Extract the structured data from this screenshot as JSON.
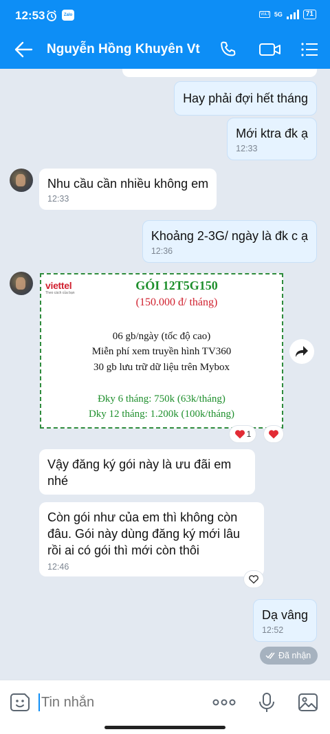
{
  "status_bar": {
    "time": "12:53",
    "zalo_label": "Zalo",
    "network": "5G",
    "volte": "VoLTE",
    "battery": "71"
  },
  "header": {
    "contact_name": "Nguyễn Hồng Khuyên Vt",
    "back_icon": "arrow-left-icon",
    "call_icon": "phone-icon",
    "video_icon": "video-camera-icon",
    "menu_icon": "list-menu-icon",
    "color": "#0d8ef6"
  },
  "messages": [
    {
      "from": "me",
      "text": "Hay phải đợi hết tháng",
      "time": ""
    },
    {
      "from": "me",
      "text": "Mới ktra đk ạ",
      "time": "12:33"
    },
    {
      "from": "them",
      "text": "Nhu cầu cần nhiều không em",
      "time": "12:33"
    },
    {
      "from": "me",
      "text": "Khoảng 2-3G/ ngày là đk c ạ",
      "time": "12:36"
    },
    {
      "from": "them",
      "text": "Vậy đăng ký gói này là ưu đãi em nhé",
      "time": ""
    },
    {
      "from": "them",
      "text": "Còn gói như của em thì không còn đâu. Gói này dùng đăng ký mới lâu rồi ai có gói thì mới còn thôi",
      "time": "12:46"
    },
    {
      "from": "me",
      "text": "Dạ vâng",
      "time": "12:52"
    }
  ],
  "package_image": {
    "brand": "viettel",
    "brand_tagline": "Theo cách của bạn",
    "title": "GÓI 12T5G150",
    "price": "(150.000 đ/ tháng)",
    "features": [
      "06 gb/ngày (tốc độ cao)",
      "Miễn phí xem truyền hình TV360",
      "30 gb lưu trữ dữ liệu trên  Mybox"
    ],
    "offers": [
      "Đky 6 tháng: 750k (63k/tháng)",
      "Dky 12 tháng: 1.200k (100k/tháng)"
    ]
  },
  "reactions": {
    "heart_count": "1"
  },
  "received_status": "Đã nhận",
  "composer": {
    "placeholder": "Tin nhắn",
    "sticker_icon": "sticker-face-icon",
    "more_icon": "more-dots-icon",
    "mic_icon": "microphone-icon",
    "image_icon": "image-gallery-icon"
  }
}
